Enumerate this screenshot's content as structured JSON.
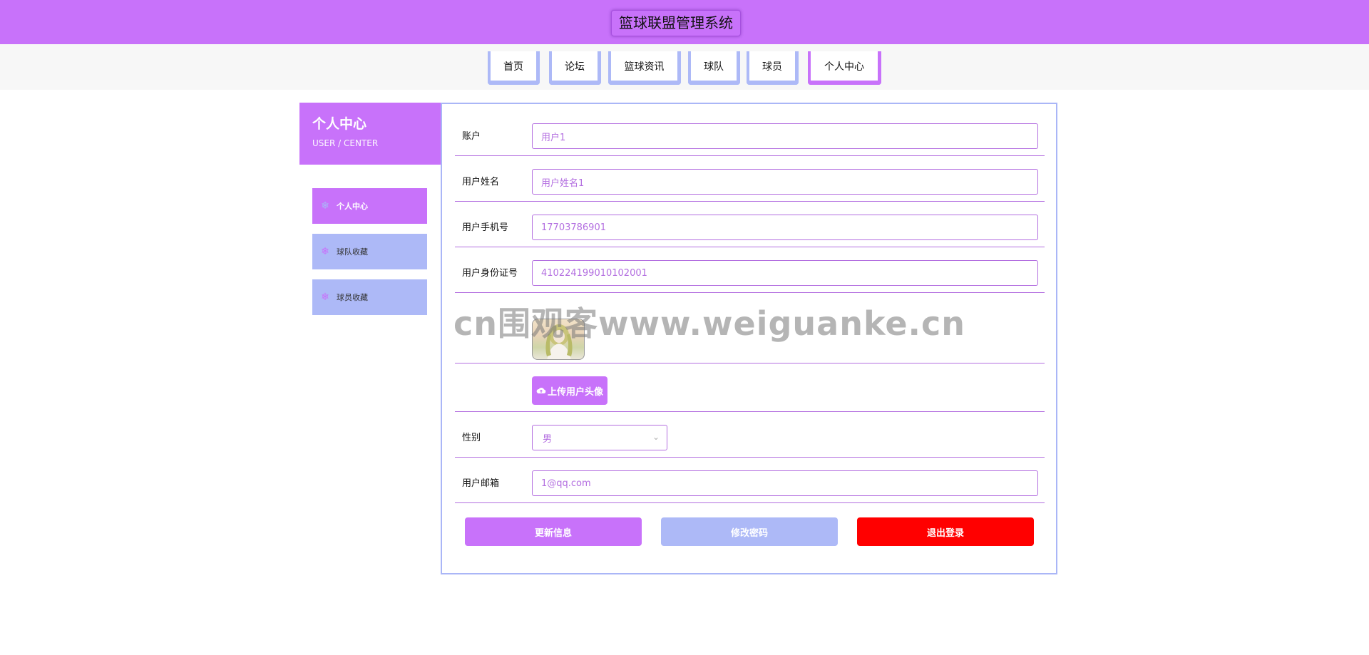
{
  "header": {
    "title": "篮球联盟管理系统"
  },
  "nav": {
    "items": [
      {
        "label": "首页"
      },
      {
        "label": "论坛"
      },
      {
        "label": "篮球资讯"
      },
      {
        "label": "球队"
      },
      {
        "label": "球员"
      },
      {
        "label": "个人中心",
        "active": true
      }
    ]
  },
  "sidebar": {
    "title": "个人中心",
    "subtitle": "USER / CENTER",
    "items": [
      {
        "label": "个人中心",
        "active": true,
        "icon": "snowflake-icon"
      },
      {
        "label": "球队收藏",
        "icon": "snowflake-icon"
      },
      {
        "label": "球员收藏",
        "icon": "snowflake-icon"
      }
    ]
  },
  "form": {
    "account": {
      "label": "账户",
      "value": "用户1"
    },
    "name": {
      "label": "用户姓名",
      "value": "用户姓名1"
    },
    "phone": {
      "label": "用户手机号",
      "value": "17703786901"
    },
    "idcard": {
      "label": "用户身份证号",
      "value": "410224199010102001"
    },
    "upload_label": "上传用户头像",
    "gender": {
      "label": "性别",
      "value": "男"
    },
    "email": {
      "label": "用户邮箱",
      "value": "1@qq.com"
    }
  },
  "actions": {
    "update": "更新信息",
    "change_password": "修改密码",
    "logout": "退出登录"
  },
  "watermark": "cn围观客www.weiguanke.cn",
  "colors": {
    "primary": "#c872fa",
    "secondary": "#adb9f7",
    "danger": "#ff0000",
    "border": "#b36ee0"
  }
}
